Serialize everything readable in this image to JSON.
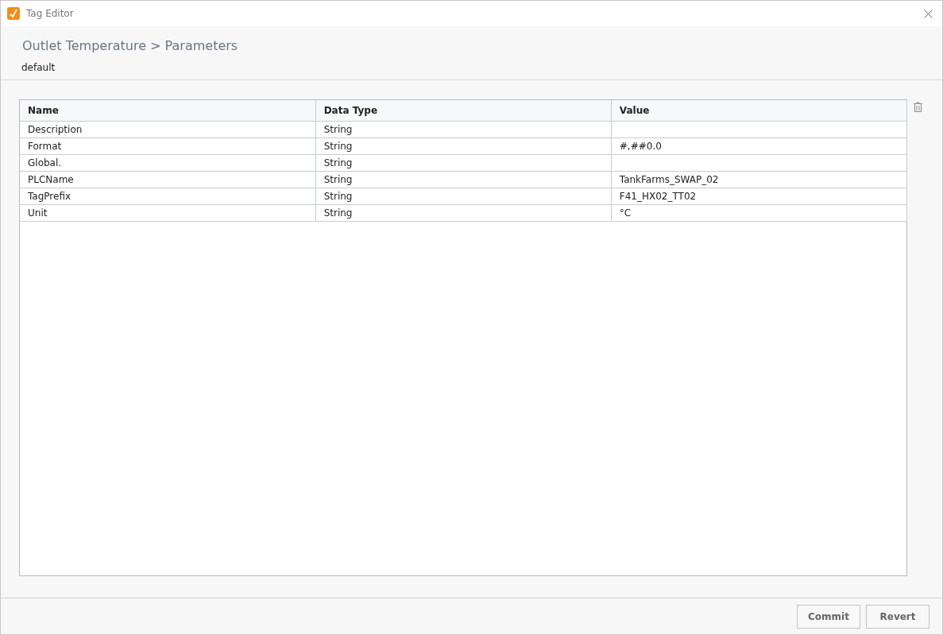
{
  "window": {
    "title": "Tag Editor"
  },
  "header": {
    "breadcrumb": "Outlet Temperature > Parameters",
    "subtitle": "default"
  },
  "table": {
    "columns": [
      "Name",
      "Data Type",
      "Value"
    ],
    "rows": [
      {
        "name": "Description",
        "data_type": "String"
      },
      {
        "name": "Format",
        "data_type": "String",
        "value": "#,##0.0"
      },
      {
        "name": "Global.",
        "data_type": "String"
      },
      {
        "name": "PLCName",
        "data_type": "String",
        "value": "TankFarms_SWAP_02"
      },
      {
        "name": "TagPrefix",
        "data_type": "String",
        "value": "F41_HX02_TT02"
      },
      {
        "name": "Unit",
        "data_type": "String",
        "value": "°C"
      }
    ]
  },
  "buttons": [
    "Commit",
    "Revert"
  ]
}
